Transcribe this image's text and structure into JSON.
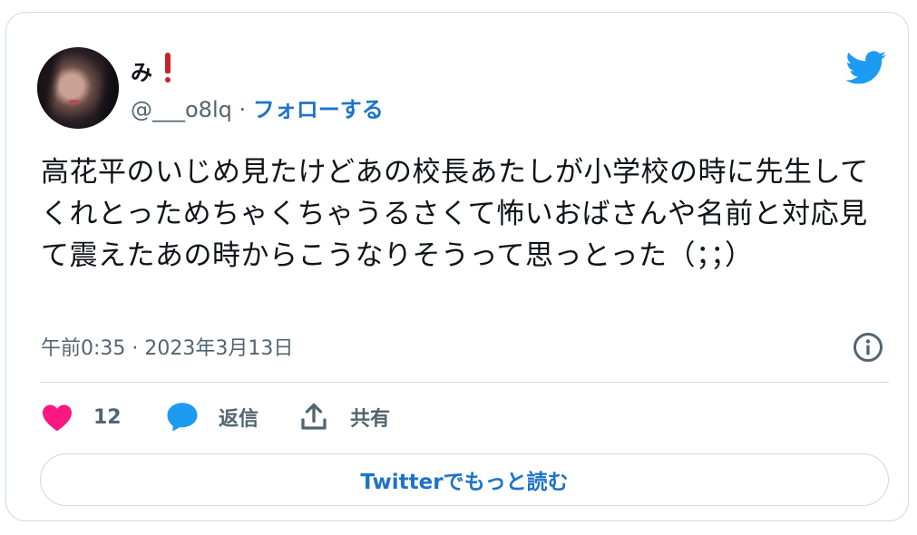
{
  "author": {
    "display_name": "み",
    "handle": "@___o8lq",
    "separator": "·",
    "follow_label": "フォローする"
  },
  "tweet": {
    "text": "高花平のいじめ見たけどあの校長あたしが小学校の時に先生してくれとっためちゃくちゃうるさくて怖いおばさんや名前と対応見て震えたあの時からこうなりそうって思っとった（；；）",
    "timestamp": "午前0:35 · 2023年3月13日"
  },
  "actions": {
    "like_count": "12",
    "reply_label": "返信",
    "share_label": "共有"
  },
  "read_more_label": "Twitterでもっと読む",
  "colors": {
    "brand_blue": "#1d9bf0",
    "link_blue": "#1d73c9",
    "like_pink": "#f91880",
    "reply_blue": "#1d9bf0",
    "text_secondary": "#536471",
    "border": "#cfd9de"
  },
  "icons": {
    "logo": "twitter-bird-icon",
    "info": "info-icon",
    "like": "heart-icon",
    "reply": "speech-bubble-icon",
    "share": "share-upload-icon",
    "name_emoji": "red-exclamation-icon"
  }
}
